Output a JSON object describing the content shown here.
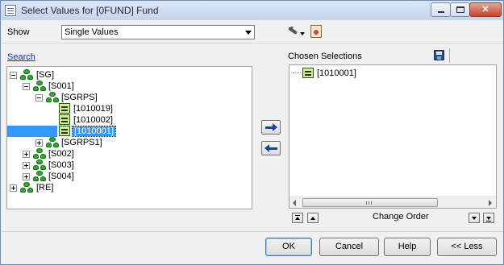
{
  "window": {
    "title": "Select Values for [0FUND] Fund",
    "controls": {
      "minimize_icon": "minimize-icon",
      "maximize_icon": "maximize-icon",
      "close_glyph": "✕"
    }
  },
  "toolbar": {
    "show_label": "Show",
    "show_value": "Single Values",
    "settings_icon": "wrench-settings-icon",
    "dropdown_icon": "chevron-down-icon",
    "clipboard_icon": "clipboard-icon"
  },
  "search": {
    "link_label": "Search"
  },
  "tree": {
    "nodes": [
      {
        "label": "[SG]",
        "icon": "hierarchy",
        "expander": "minus",
        "selected": false
      },
      {
        "label": "[S001]",
        "icon": "hierarchy",
        "expander": "minus",
        "selected": false
      },
      {
        "label": "[SGRPS]",
        "icon": "hierarchy",
        "expander": "minus",
        "selected": false
      },
      {
        "label": "[1010019]",
        "icon": "value",
        "expander": "",
        "selected": false
      },
      {
        "label": "[1010002]",
        "icon": "value",
        "expander": "",
        "selected": false
      },
      {
        "label": "[1010001]",
        "icon": "value",
        "expander": "",
        "selected": true
      },
      {
        "label": "[SGRPS1]",
        "icon": "hierarchy",
        "expander": "plus",
        "selected": false
      },
      {
        "label": "[S002]",
        "icon": "hierarchy",
        "expander": "plus",
        "selected": false
      },
      {
        "label": "[S003]",
        "icon": "hierarchy",
        "expander": "plus",
        "selected": false
      },
      {
        "label": "[S004]",
        "icon": "hierarchy",
        "expander": "plus",
        "selected": false
      },
      {
        "label": "[RE]",
        "icon": "hierarchy",
        "expander": "plus",
        "selected": false
      }
    ]
  },
  "chosen": {
    "label": "Chosen Selections",
    "save_icon": "save-icon",
    "items": [
      {
        "label": "[1010001]"
      }
    ]
  },
  "order": {
    "label": "Change Order"
  },
  "buttons": {
    "ok": "OK",
    "cancel": "Cancel",
    "help": "Help",
    "less": "<< Less"
  },
  "colors": {
    "selection": "#3399ff",
    "link": "#0033cc",
    "arrow": "#1a3fb0",
    "hierarchy_icon": "#2eaa2e",
    "value_icon": "#d8ec98"
  }
}
